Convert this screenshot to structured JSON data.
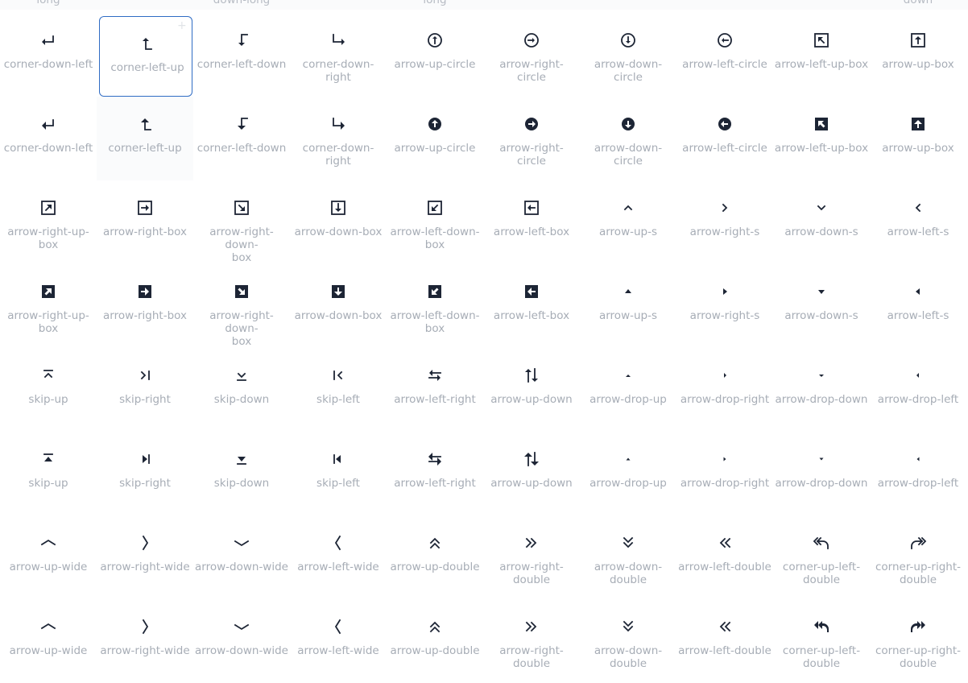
{
  "top_labels": [
    "long",
    "down-long",
    "long",
    "down"
  ],
  "rows": [
    [
      {
        "icon": "corner-down-left-icon",
        "label": "corner-down-left"
      },
      {
        "icon": "corner-left-up-icon",
        "label": "corner-left-up"
      },
      {
        "icon": "corner-left-down-icon",
        "label": "corner-left-down"
      },
      {
        "icon": "corner-down-right-icon",
        "label": "corner-down-right"
      },
      {
        "icon": "arrow-up-circle-icon",
        "label": "arrow-up-circle"
      },
      {
        "icon": "arrow-right-circle-icon",
        "label": "arrow-right-circle"
      },
      {
        "icon": "arrow-down-circle-icon",
        "label": "arrow-down-circle"
      },
      {
        "icon": "arrow-left-circle-icon",
        "label": "arrow-left-circle"
      },
      {
        "icon": "arrow-left-up-box-icon",
        "label": "arrow-left-up-box"
      },
      {
        "icon": "arrow-up-box-icon",
        "label": "arrow-up-box"
      }
    ],
    [
      {
        "icon": "corner-down-left-fill-icon",
        "label": "corner-down-left"
      },
      {
        "icon": "corner-left-up-fill-icon",
        "label": "corner-left-up"
      },
      {
        "icon": "corner-left-down-fill-icon",
        "label": "corner-left-down"
      },
      {
        "icon": "corner-down-right-fill-icon",
        "label": "corner-down-right"
      },
      {
        "icon": "arrow-up-circle-fill-icon",
        "label": "arrow-up-circle"
      },
      {
        "icon": "arrow-right-circle-fill-icon",
        "label": "arrow-right-circle"
      },
      {
        "icon": "arrow-down-circle-fill-icon",
        "label": "arrow-down-circle"
      },
      {
        "icon": "arrow-left-circle-fill-icon",
        "label": "arrow-left-circle"
      },
      {
        "icon": "arrow-left-up-box-fill-icon",
        "label": "arrow-left-up-box"
      },
      {
        "icon": "arrow-up-box-fill-icon",
        "label": "arrow-up-box"
      }
    ],
    [
      {
        "icon": "arrow-right-up-box-icon",
        "label": "arrow-right-up-box"
      },
      {
        "icon": "arrow-right-box-icon",
        "label": "arrow-right-box"
      },
      {
        "icon": "arrow-right-down-box-icon",
        "label": "arrow-right-down-box"
      },
      {
        "icon": "arrow-down-box-icon",
        "label": "arrow-down-box"
      },
      {
        "icon": "arrow-left-down-box-icon",
        "label": "arrow-left-down-box"
      },
      {
        "icon": "arrow-left-box-icon",
        "label": "arrow-left-box"
      },
      {
        "icon": "arrow-up-s-icon",
        "label": "arrow-up-s"
      },
      {
        "icon": "arrow-right-s-icon",
        "label": "arrow-right-s"
      },
      {
        "icon": "arrow-down-s-icon",
        "label": "arrow-down-s"
      },
      {
        "icon": "arrow-left-s-icon",
        "label": "arrow-left-s"
      }
    ],
    [
      {
        "icon": "arrow-right-up-box-fill-icon",
        "label": "arrow-right-up-box"
      },
      {
        "icon": "arrow-right-box-fill-icon",
        "label": "arrow-right-box"
      },
      {
        "icon": "arrow-right-down-box-fill-icon",
        "label": "arrow-right-down-box"
      },
      {
        "icon": "arrow-down-box-fill-icon",
        "label": "arrow-down-box"
      },
      {
        "icon": "arrow-left-down-box-fill-icon",
        "label": "arrow-left-down-box"
      },
      {
        "icon": "arrow-left-box-fill-icon",
        "label": "arrow-left-box"
      },
      {
        "icon": "arrow-up-s-fill-icon",
        "label": "arrow-up-s"
      },
      {
        "icon": "arrow-right-s-fill-icon",
        "label": "arrow-right-s"
      },
      {
        "icon": "arrow-down-s-fill-icon",
        "label": "arrow-down-s"
      },
      {
        "icon": "arrow-left-s-fill-icon",
        "label": "arrow-left-s"
      }
    ],
    [
      {
        "icon": "skip-up-icon",
        "label": "skip-up"
      },
      {
        "icon": "skip-right-icon",
        "label": "skip-right"
      },
      {
        "icon": "skip-down-icon",
        "label": "skip-down"
      },
      {
        "icon": "skip-left-icon",
        "label": "skip-left"
      },
      {
        "icon": "arrow-left-right-icon",
        "label": "arrow-left-right"
      },
      {
        "icon": "arrow-up-down-icon",
        "label": "arrow-up-down"
      },
      {
        "icon": "arrow-drop-up-icon",
        "label": "arrow-drop-up"
      },
      {
        "icon": "arrow-drop-right-icon",
        "label": "arrow-drop-right"
      },
      {
        "icon": "arrow-drop-down-icon",
        "label": "arrow-drop-down"
      },
      {
        "icon": "arrow-drop-left-icon",
        "label": "arrow-drop-left"
      }
    ],
    [
      {
        "icon": "skip-up-fill-icon",
        "label": "skip-up"
      },
      {
        "icon": "skip-right-fill-icon",
        "label": "skip-right"
      },
      {
        "icon": "skip-down-fill-icon",
        "label": "skip-down"
      },
      {
        "icon": "skip-left-fill-icon",
        "label": "skip-left"
      },
      {
        "icon": "arrow-left-right-fill-icon",
        "label": "arrow-left-right"
      },
      {
        "icon": "arrow-up-down-fill-icon",
        "label": "arrow-up-down"
      },
      {
        "icon": "arrow-drop-up-fill-icon",
        "label": "arrow-drop-up"
      },
      {
        "icon": "arrow-drop-right-fill-icon",
        "label": "arrow-drop-right"
      },
      {
        "icon": "arrow-drop-down-fill-icon",
        "label": "arrow-drop-down"
      },
      {
        "icon": "arrow-drop-left-fill-icon",
        "label": "arrow-drop-left"
      }
    ],
    [
      {
        "icon": "arrow-up-wide-icon",
        "label": "arrow-up-wide"
      },
      {
        "icon": "arrow-right-wide-icon",
        "label": "arrow-right-wide"
      },
      {
        "icon": "arrow-down-wide-icon",
        "label": "arrow-down-wide"
      },
      {
        "icon": "arrow-left-wide-icon",
        "label": "arrow-left-wide"
      },
      {
        "icon": "arrow-up-double-icon",
        "label": "arrow-up-double"
      },
      {
        "icon": "arrow-right-double-icon",
        "label": "arrow-right-double"
      },
      {
        "icon": "arrow-down-double-icon",
        "label": "arrow-down-double"
      },
      {
        "icon": "arrow-left-double-icon",
        "label": "arrow-left-double"
      },
      {
        "icon": "corner-up-left-double-icon",
        "label": "corner-up-left-double"
      },
      {
        "icon": "corner-up-right-double-icon",
        "label": "corner-up-right-double"
      }
    ],
    [
      {
        "icon": "arrow-up-wide-fill-icon",
        "label": "arrow-up-wide"
      },
      {
        "icon": "arrow-right-wide-fill-icon",
        "label": "arrow-right-wide"
      },
      {
        "icon": "arrow-down-wide-fill-icon",
        "label": "arrow-down-wide"
      },
      {
        "icon": "arrow-left-wide-fill-icon",
        "label": "arrow-left-wide"
      },
      {
        "icon": "arrow-up-double-fill-icon",
        "label": "arrow-up-double"
      },
      {
        "icon": "arrow-right-double-fill-icon",
        "label": "arrow-right-double"
      },
      {
        "icon": "arrow-down-double-fill-icon",
        "label": "arrow-down-double"
      },
      {
        "icon": "arrow-left-double-fill-icon",
        "label": "arrow-left-double"
      },
      {
        "icon": "corner-up-left-double-fill-icon",
        "label": "corner-up-left-double"
      },
      {
        "icon": "corner-up-right-double-fill-icon",
        "label": "corner-up-right-double"
      }
    ]
  ],
  "selected": {
    "row": 0,
    "col": 1
  },
  "colors": {
    "icon": "#1d2535",
    "label": "#a7adb6",
    "selection_border": "#2f6cc4",
    "background": "#ffffff"
  }
}
